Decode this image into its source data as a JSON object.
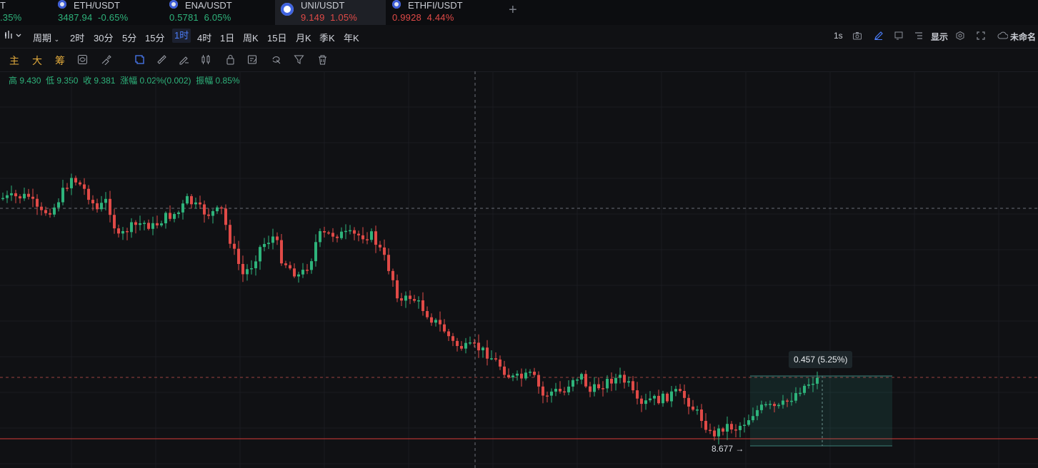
{
  "tickers": [
    {
      "symbol": "T",
      "price": "",
      "change": ".35%",
      "trend": "green",
      "active": false
    },
    {
      "symbol": "ETH/USDT",
      "price": "3487.94",
      "change": "-0.65%",
      "trend": "green",
      "active": false
    },
    {
      "symbol": "ENA/USDT",
      "price": "0.5781",
      "change": "6.05%",
      "trend": "green",
      "active": false
    },
    {
      "symbol": "UNI/USDT",
      "price": "9.149",
      "change": "1.05%",
      "trend": "red",
      "active": true
    },
    {
      "symbol": "ETHFI/USDT",
      "price": "0.9928",
      "change": "4.44%",
      "trend": "red",
      "active": false
    }
  ],
  "add_tab": "+",
  "toolbar": {
    "period_label": "周期",
    "intervals": [
      "2时",
      "30分",
      "5分",
      "15分",
      "1时",
      "4时",
      "1日",
      "周K",
      "15日",
      "月K",
      "季K",
      "年K"
    ],
    "active_interval": "1时",
    "refresh": "1s",
    "display_label": "显示",
    "layout_name": "未命名"
  },
  "indicators": [
    "主",
    "大",
    "筹"
  ],
  "ohlc": {
    "high": "高 9.430",
    "low": "低 9.350",
    "close": "收 9.381",
    "change": "涨幅 0.02%(0.002)",
    "amplitude": "振幅 0.85%"
  },
  "measure": {
    "label": "0.457 (5.25%)",
    "low_label": "8.677 →"
  },
  "colors": {
    "up": "#2eb37b",
    "down": "#e04a47",
    "accent": "#4a7cf7",
    "background": "#101114"
  },
  "icons": [
    "chart-type-icon",
    "camera-icon",
    "pencil-icon",
    "rectangle-icon",
    "list-icon",
    "settings-icon",
    "fullscreen-icon",
    "cloud-icon"
  ]
}
